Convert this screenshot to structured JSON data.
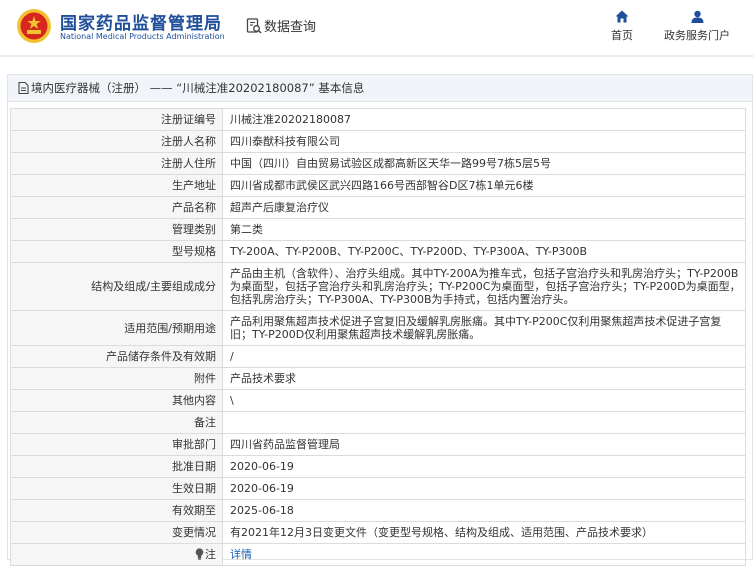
{
  "header": {
    "brand_cn": "国家药品监督管理局",
    "brand_en": "National Medical Products Administration",
    "search_label": "数据查询",
    "nav": [
      {
        "label": "首页",
        "icon": "home-icon"
      },
      {
        "label": "政务服务门户",
        "icon": "user-icon"
      }
    ]
  },
  "panel": {
    "title": "境内医疗器械（注册） —— “川械注准20202180087” 基本信息"
  },
  "rows": [
    {
      "label": "注册证编号",
      "value": "川械注准20202180087"
    },
    {
      "label": "注册人名称",
      "value": "四川泰猷科技有限公司"
    },
    {
      "label": "注册人住所",
      "value": "中国（四川）自由贸易试验区成都高新区天华一路99号7栋5层5号"
    },
    {
      "label": "生产地址",
      "value": "四川省成都市武侯区武兴四路166号西部智谷D区7栋1单元6楼"
    },
    {
      "label": "产品名称",
      "value": "超声产后康复治疗仪"
    },
    {
      "label": "管理类别",
      "value": "第二类"
    },
    {
      "label": "型号规格",
      "value": "TY-200A、TY-P200B、TY-P200C、TY-P200D、TY-P300A、TY-P300B"
    },
    {
      "label": "结构及组成/主要组成成分",
      "value": "产品由主机（含软件）、治疗头组成。其中TY-200A为推车式，包括子宫治疗头和乳房治疗头；TY-P200B为桌面型，包括子宫治疗头和乳房治疗头；TY-P200C为桌面型，包括子宫治疗头；TY-P200D为桌面型，包括乳房治疗头；TY-P300A、TY-P300B为手持式，包括内置治疗头。"
    },
    {
      "label": "适用范围/预期用途",
      "value": "产品利用聚焦超声技术促进子宫复旧及缓解乳房胀痛。其中TY-P200C仅利用聚焦超声技术促进子宫复旧；TY-P200D仅利用聚焦超声技术缓解乳房胀痛。"
    },
    {
      "label": "产品储存条件及有效期",
      "value": "/"
    },
    {
      "label": "附件",
      "value": "产品技术要求"
    },
    {
      "label": "其他内容",
      "value": "\\"
    },
    {
      "label": "备注",
      "value": ""
    },
    {
      "label": "审批部门",
      "value": "四川省药品监督管理局"
    },
    {
      "label": "批准日期",
      "value": "2020-06-19"
    },
    {
      "label": "生效日期",
      "value": "2020-06-19"
    },
    {
      "label": "有效期至",
      "value": "2025-06-18"
    },
    {
      "label": "变更情况",
      "value": "有2021年12月3日变更文件（变更型号规格、结构及组成、适用范围、产品技术要求）"
    }
  ],
  "note_row": {
    "label": "注",
    "icon": "bulb-icon",
    "link": "详情"
  },
  "colors": {
    "brand_blue": "#1f4e9a",
    "link_blue": "#1a5fb4",
    "emblem_red": "#d7261d",
    "emblem_gold": "#f2c230"
  }
}
